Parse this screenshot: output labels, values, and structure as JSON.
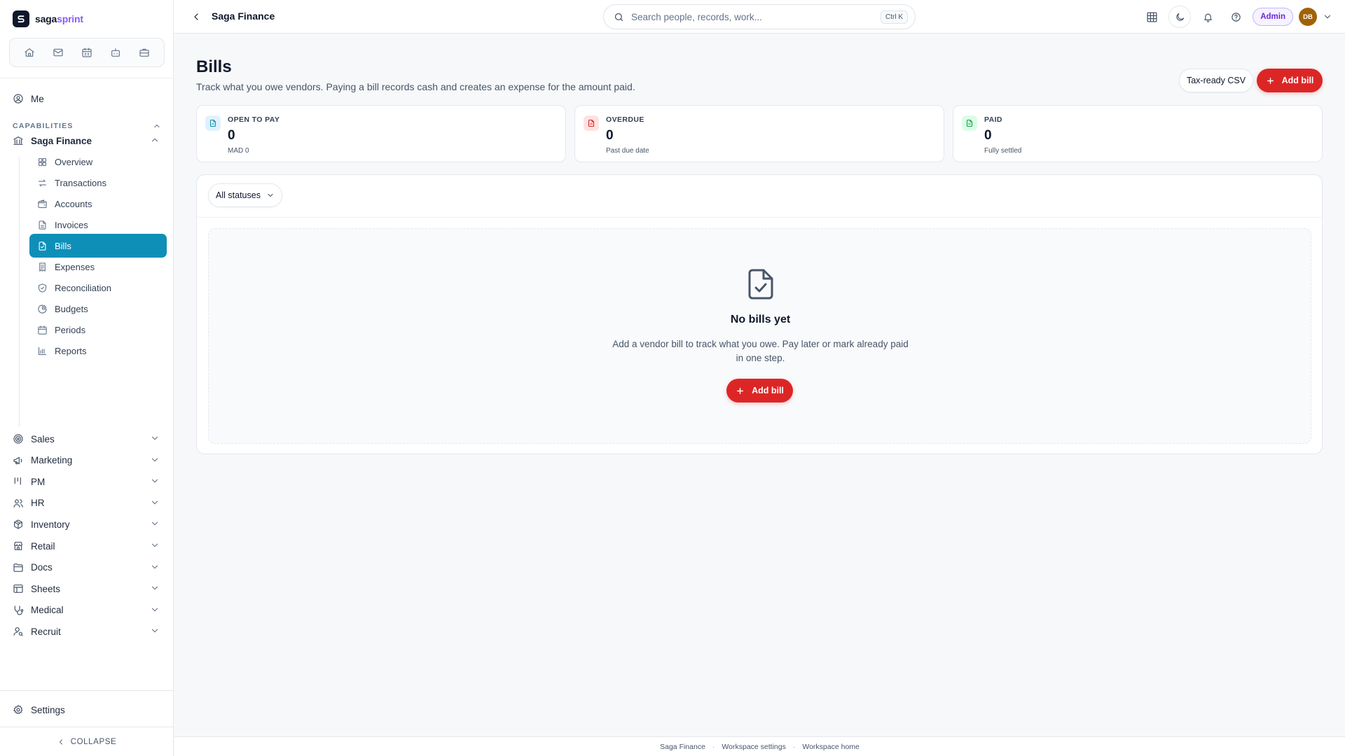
{
  "brand": {
    "name_main": "saga",
    "name_accent": "sprint"
  },
  "sidebar": {
    "quick_icons": [
      "home-icon",
      "mail-icon",
      "calendar-icon",
      "bot-icon",
      "briefcase-icon"
    ],
    "me_label": "Me",
    "capabilities_label": "CAPABILITIES",
    "active_module": "Saga Finance",
    "finance_items": [
      {
        "label": "Overview",
        "icon": "grid-icon"
      },
      {
        "label": "Transactions",
        "icon": "arrows-icon"
      },
      {
        "label": "Accounts",
        "icon": "wallet-icon"
      },
      {
        "label": "Invoices",
        "icon": "file-text-icon"
      },
      {
        "label": "Bills",
        "icon": "file-icon",
        "active": true
      },
      {
        "label": "Expenses",
        "icon": "receipt-icon"
      },
      {
        "label": "Reconciliation",
        "icon": "shield-check-icon"
      },
      {
        "label": "Budgets",
        "icon": "pie-icon"
      },
      {
        "label": "Periods",
        "icon": "calendar-icon"
      },
      {
        "label": "Reports",
        "icon": "bar-chart-icon"
      }
    ],
    "modules": [
      {
        "label": "Sales",
        "icon": "target-icon"
      },
      {
        "label": "Marketing",
        "icon": "megaphone-icon"
      },
      {
        "label": "PM",
        "icon": "kanban-icon"
      },
      {
        "label": "HR",
        "icon": "users-icon"
      },
      {
        "label": "Inventory",
        "icon": "package-icon"
      },
      {
        "label": "Retail",
        "icon": "store-icon"
      },
      {
        "label": "Docs",
        "icon": "folder-icon"
      },
      {
        "label": "Sheets",
        "icon": "table-icon"
      },
      {
        "label": "Medical",
        "icon": "stethoscope-icon"
      },
      {
        "label": "Recruit",
        "icon": "user-search-icon"
      }
    ],
    "settings_label": "Settings",
    "collapse_label": "COLLAPSE"
  },
  "topbar": {
    "breadcrumb": "Saga Finance",
    "search_placeholder": "Search people, records, work...",
    "search_shortcut": "Ctrl K",
    "role_badge": "Admin",
    "avatar_initials": "DB"
  },
  "page": {
    "title": "Bills",
    "subtitle": "Track what you owe vendors. Paying a bill records cash and creates an expense for the amount paid.",
    "export_button": "Tax-ready CSV",
    "add_button": "Add bill"
  },
  "stats": [
    {
      "label": "OPEN TO PAY",
      "value": "0",
      "note": "MAD 0",
      "color": "#0891b2",
      "bg": "#e0f2fe"
    },
    {
      "label": "OVERDUE",
      "value": "0",
      "note": "Past due date",
      "color": "#dc2626",
      "bg": "#fee2e2"
    },
    {
      "label": "PAID",
      "value": "0",
      "note": "Fully settled",
      "color": "#16a34a",
      "bg": "#dcfce7"
    }
  ],
  "filter": {
    "status_value": "All statuses"
  },
  "empty_state": {
    "title": "No bills yet",
    "text": "Add a vendor bill to track what you owe. Pay later or mark already paid in one step.",
    "button": "Add bill"
  },
  "footer": {
    "links": [
      "Saga Finance",
      "Workspace settings",
      "Workspace home"
    ]
  },
  "colors": {
    "accent": "#0e8fb8",
    "primary": "#dc2626",
    "brand_accent": "#8b5cf6",
    "admin": "#6d28d9"
  }
}
